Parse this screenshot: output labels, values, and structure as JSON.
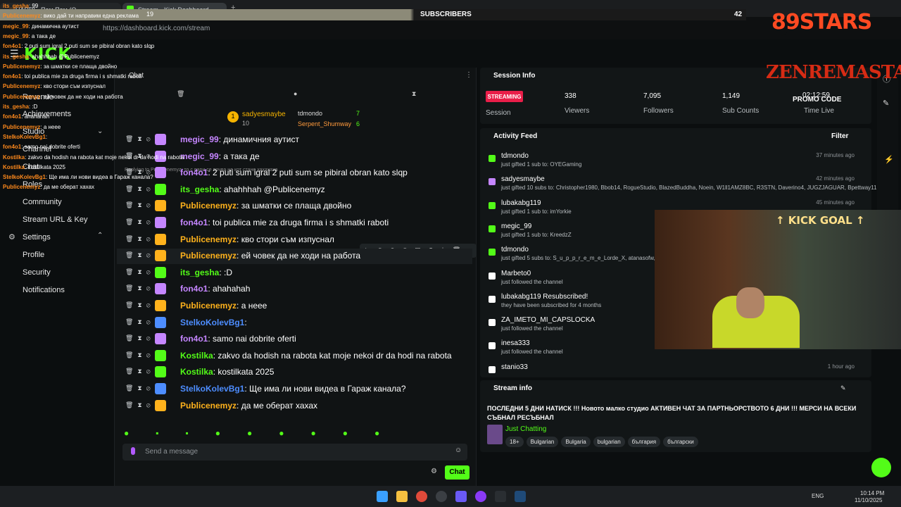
{
  "browser": {
    "tabs": [
      {
        "label": "HARDI - Пам Пам (O..."
      },
      {
        "label": "Stream - Kick Dashboard"
      }
    ],
    "url": "https://dashboard.kick.com/stream"
  },
  "overlay": {
    "sub_count_left": "19",
    "sub_label": "SUBSCRIBERS",
    "sub_count_right": "42",
    "stars": "89STARS",
    "brand": "ZENREMASTA",
    "promo": "PROMO CODE",
    "goal": "KICK GOAL",
    "timer": "02:12:59",
    "lines": [
      [
        "its_gesha",
        "99"
      ],
      [
        "Publicenemyz",
        "вико дай ти направим една реклама"
      ],
      [
        "megic_99",
        "динамична аутист"
      ],
      [
        "megic_99",
        "а така де"
      ],
      [
        "fon4o1",
        "2 puti sum igral 2 puti sum se pibiral obran kato slqp"
      ],
      [
        "its_gesha",
        "ahahhhah @Publicenemyz"
      ],
      [
        "Publicenemyz",
        "за шматки се плаща двойно"
      ],
      [
        "fon4o1",
        "toi publica mie za druga firma i s shmatki raboti"
      ],
      [
        "Publicenemyz",
        "кво стори съм изпуснал"
      ],
      [
        "Publicenemyz",
        "ей човек да не ходи на работа"
      ],
      [
        "its_gesha",
        ":D"
      ],
      [
        "fon4o1",
        "ahahahah"
      ],
      [
        "Publicenemyz",
        "а нееe"
      ],
      [
        "StelkoKolevBg1",
        ""
      ],
      [
        "fon4o1",
        "samo nai dobrite oferti"
      ],
      [
        "Kostilka",
        "zakvo da hodish na rabota kat moje nekoi dr da hodi na rabota"
      ],
      [
        "Kostilka",
        "kostilkata 2025"
      ],
      [
        "StelkoKolevBg1",
        "Ще има ли нови видеа в Гараж канала?"
      ],
      [
        "Publicenemyz",
        "да ме оберат хахах"
      ]
    ]
  },
  "sidebar": {
    "items": [
      "Revenue",
      "Achievements",
      "Studio",
      "Channel",
      "Chat",
      "Roles",
      "Community",
      "Stream URL & Key",
      "Settings",
      "Profile",
      "Security",
      "Notifications"
    ]
  },
  "chat": {
    "title": "Chat",
    "leaders": [
      {
        "name": "sadyesmaybe",
        "count": "10"
      },
      {
        "name": "tdmondo",
        "count": "7"
      },
      {
        "name": "Serpent_Shumway",
        "count": "6"
      }
    ],
    "reply_hint": "Replying to Publicenemyz: то с пари се почва на кот стане хахахаха",
    "messages": [
      {
        "user": "megic_99",
        "text": "динамичния аутист",
        "color": "#c586ff"
      },
      {
        "user": "megic_99",
        "text": "а така де",
        "color": "#c586ff"
      },
      {
        "user": "fon4o1",
        "text": "2 puti sum igral 2 puti sum se pibiral obran kato slqp",
        "color": "#c586ff"
      },
      {
        "user": "its_gesha",
        "text": "ahahhhah @Publicenemyz",
        "color": "#53fc18"
      },
      {
        "user": "Publicenemyz",
        "text": "за шматки се плаща двойно",
        "color": "#ffb21c"
      },
      {
        "user": "fon4o1",
        "text": "toi publica mie za druga firma i s shmatki raboti",
        "color": "#c586ff"
      },
      {
        "user": "Publicenemyz",
        "text": "кво стори съм изпуснал",
        "color": "#ffb21c"
      },
      {
        "user": "Publicenemyz",
        "text": "ей човек да не ходи на работа",
        "color": "#ffb21c"
      },
      {
        "user": "its_gesha",
        "text": ":D",
        "color": "#53fc18"
      },
      {
        "user": "fon4o1",
        "text": "ahahahah",
        "color": "#c586ff"
      },
      {
        "user": "Publicenemyz",
        "text": "а нееe",
        "color": "#ffb21c"
      },
      {
        "user": "StelkoKolevBg1",
        "text": "",
        "color": "#4d8dff"
      },
      {
        "user": "fon4o1",
        "text": "samo nai dobrite oferti",
        "color": "#c586ff"
      },
      {
        "user": "Kostilka",
        "text": "zakvo da hodish na rabota kat moje nekoi dr da hodi na rabota",
        "color": "#53fc18"
      },
      {
        "user": "Kostilka",
        "text": "kostilkata 2025",
        "color": "#53fc18"
      },
      {
        "user": "StelkoKolevBg1",
        "text": "Ще има ли нови видеа в Гараж канала?",
        "color": "#4d8dff"
      },
      {
        "user": "Publicenemyz",
        "text": "да ме оберат хахах",
        "color": "#ffb21c"
      }
    ],
    "input_placeholder": "Send a message",
    "send_label": "Chat"
  },
  "session": {
    "title": "Session Info",
    "status": "STREAMING",
    "status_label": "Session",
    "viewers": "338",
    "viewers_label": "Viewers",
    "followers": "7,095",
    "followers_label": "Followers",
    "subs": "1,149",
    "subs_label": "Sub Counts",
    "time_label": "Time Live"
  },
  "activity": {
    "title": "Activity Feed",
    "filter": "Filter",
    "items": [
      {
        "name": "tdmondo",
        "sub": "just gifted 1 sub to: OYEGaming",
        "time": "37 minutes ago",
        "color": "#53fc18"
      },
      {
        "name": "sadyesmaybe",
        "sub": "just gifted 10 subs to: Christopher1980, Bbob14, RogueStudio, BlazedBuddha, Noein, W1ll1AMZ8BC, R3STN, Daverino4, JUGZJAGUAR, Bpettway11",
        "time": "42 minutes ago",
        "color": "#c586ff"
      },
      {
        "name": "lubakabg119",
        "sub": "just gifted 1 sub to: imYorkie",
        "time": "45 minutes ago",
        "color": "#53fc18"
      },
      {
        "name": "megic_99",
        "sub": "just gifted 1 sub to: KreedzZ",
        "time": "",
        "color": "#53fc18"
      },
      {
        "name": "tdmondo",
        "sub": "just gifted 5 subs to: S_u_p_p_r_e_m_e_Lorde_X, atanasofw,",
        "time": "",
        "color": "#53fc18"
      },
      {
        "name": "Marbeto0",
        "sub": "just followed the channel",
        "time": "",
        "color": "#ffffff"
      },
      {
        "name": "lubakabg119 Resubscribed!",
        "sub": "they have been subscribed for 4 months",
        "time": "",
        "color": "#ffffff"
      },
      {
        "name": "ZA_IMETO_MI_CAPSLOCKA",
        "sub": "just followed the channel",
        "time": "",
        "color": "#ffffff"
      },
      {
        "name": "inesa333",
        "sub": "just followed the channel",
        "time": "1 hour ago",
        "color": "#ffffff"
      },
      {
        "name": "stanio33",
        "sub": "",
        "time": "1 hour ago",
        "color": "#ffffff"
      }
    ]
  },
  "stream_info": {
    "title": "Stream info",
    "description": "ПОСЛЕДНИ 5 ДНИ НАТИСК !!! Новото малко студио АКТИВЕН ЧАТ ЗА ПАРТНЬОРСТВОТО 6 ДНИ !!! МЕРСИ НА ВСЕКИ СЪБНАЛ РЕСЪБНАЛ",
    "category": "Just Chatting",
    "tags": [
      "18+",
      "Bulgarian",
      "Bulgaria",
      "bulgarian",
      "българия",
      "български"
    ]
  },
  "taskbar": {
    "lang": "ENG",
    "time": "10:14 PM",
    "date": "11/10/2025"
  },
  "colors": {
    "accent": "#53fc18",
    "streaming": "#e91e49"
  }
}
